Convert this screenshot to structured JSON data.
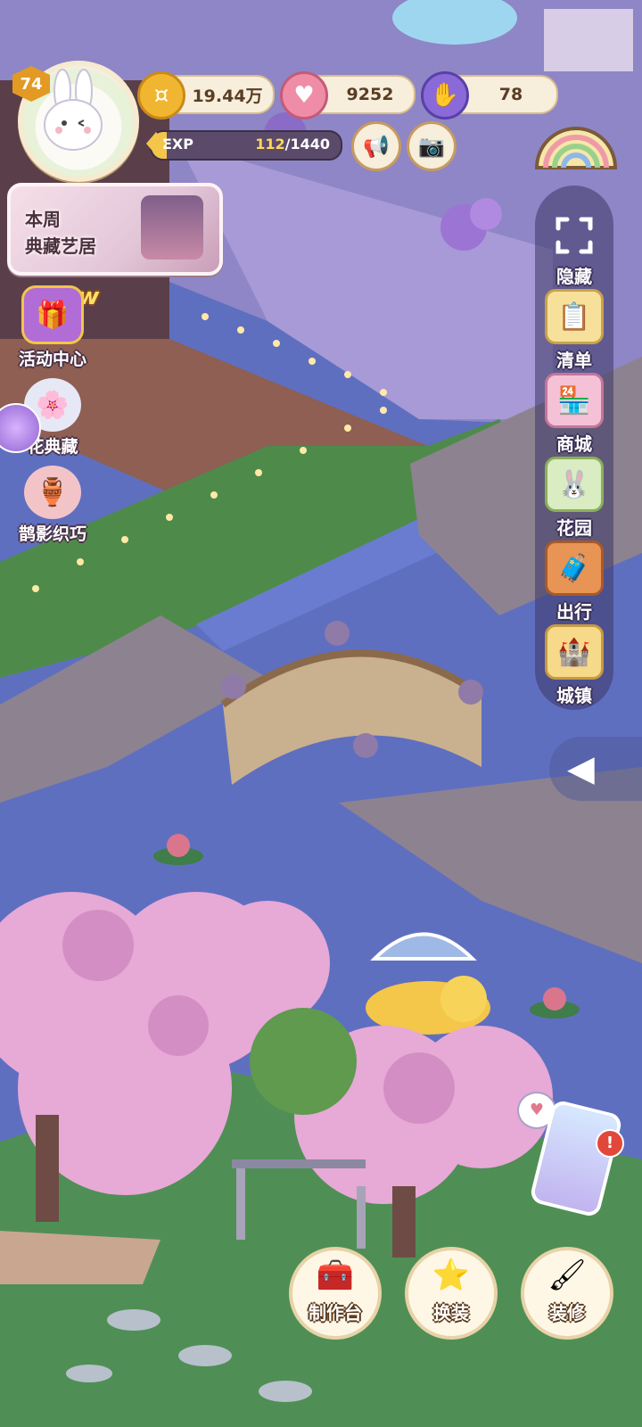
{
  "player": {
    "level": "74",
    "avatar_icon": "bunny-avatar"
  },
  "resources": {
    "coins": "19.44万",
    "hearts": "9252",
    "energy": "78"
  },
  "exp": {
    "label": "EXP",
    "current": "112",
    "total": "/1440",
    "progress_fraction": 0.078
  },
  "weekly_card": {
    "line1": "本周",
    "line2": "典藏艺居"
  },
  "left_menu": {
    "new_tag": "New",
    "items": [
      {
        "label": "活动中心",
        "icon": "gift-box-icon"
      },
      {
        "label": "花典藏",
        "icon": "flower-girl-icon"
      },
      {
        "label": "鹊影织巧",
        "icon": "vase-icon"
      }
    ]
  },
  "right_menu": {
    "items": [
      {
        "label": "隐藏",
        "icon": "fullscreen-corners-icon"
      },
      {
        "label": "清单",
        "icon": "checklist-icon"
      },
      {
        "label": "商城",
        "icon": "shop-icon"
      },
      {
        "label": "花园",
        "icon": "garden-bunny-icon"
      },
      {
        "label": "出行",
        "icon": "luggage-icon"
      },
      {
        "label": "城镇",
        "icon": "castle-icon"
      }
    ]
  },
  "bottom_bar": {
    "craft": "制作台",
    "outfit": "换装",
    "decorate": "装修"
  },
  "phone": {
    "badge": "!"
  },
  "colors": {
    "gold": "#f3c64a",
    "cherry_blossom": "#e7a9d6",
    "water": "#5f6fc0",
    "wood_deck": "#8d8290"
  }
}
